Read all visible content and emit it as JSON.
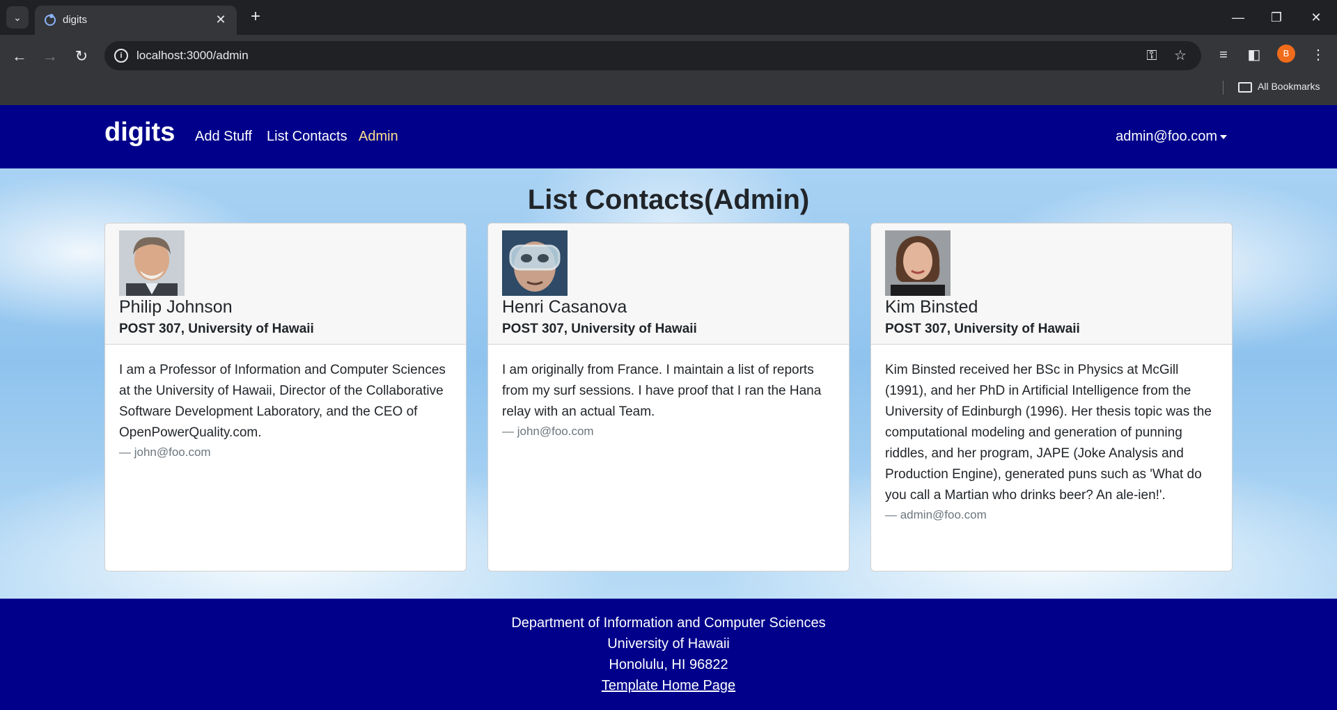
{
  "browser": {
    "tab_title": "digits",
    "url": "localhost:3000/admin",
    "profile_initial": "B",
    "bookmarks_label": "All Bookmarks"
  },
  "navbar": {
    "brand": "digits",
    "links": [
      "Add Stuff",
      "List Contacts",
      "Admin"
    ],
    "active_link": "Admin",
    "user": "admin@foo.com"
  },
  "page": {
    "title": "List Contacts(Admin)"
  },
  "contacts": [
    {
      "name": "Philip Johnson",
      "address": "POST 307, University of Hawaii",
      "description": "I am a Professor of Information and Computer Sciences at the University of Hawaii, Director of the Collaborative Software Development Laboratory, and the CEO of OpenPowerQuality.com.",
      "owner": "— john@foo.com"
    },
    {
      "name": "Henri Casanova",
      "address": "POST 307, University of Hawaii",
      "description": "I am originally from France. I maintain a list of reports from my surf sessions. I have proof that I ran the Hana relay with an actual Team.",
      "owner": "— john@foo.com"
    },
    {
      "name": "Kim Binsted",
      "address": "POST 307, University of Hawaii",
      "description": "Kim Binsted received her BSc in Physics at McGill (1991), and her PhD in Artificial Intelligence from the University of Edinburgh (1996). Her thesis topic was the computational modeling and generation of punning riddles, and her program, JAPE (Joke Analysis and Production Engine), generated puns such as 'What do you call a Martian who drinks beer? An ale-ien!'.",
      "owner": "— admin@foo.com"
    }
  ],
  "footer": {
    "line1": "Department of Information and Computer Sciences",
    "line2": "University of Hawaii",
    "line3": "Honolulu, HI 96822",
    "link": "Template Home Page"
  }
}
